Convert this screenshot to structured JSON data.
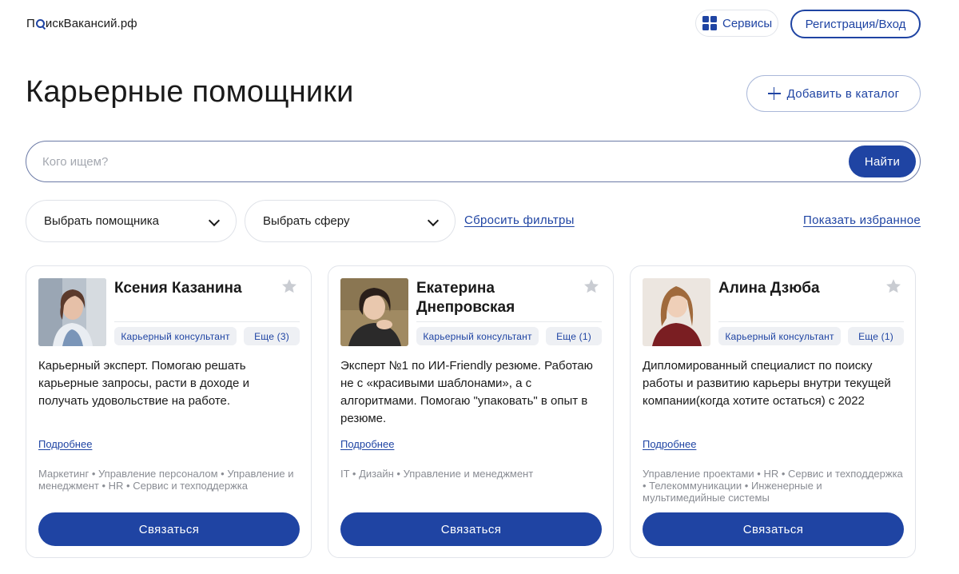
{
  "header": {
    "logo_pre": "П",
    "logo_post": "искВакансий.рф",
    "services_label": "Сервисы",
    "login_label": "Регистрация/Вход"
  },
  "page": {
    "title": "Карьерные помощники",
    "add_label": "Добавить в каталог"
  },
  "search": {
    "placeholder": "Кого ищем?",
    "value": "",
    "button_label": "Найти"
  },
  "filters": {
    "assistant_select": "Выбрать помощника",
    "sphere_select": "Выбрать сферу",
    "reset_label": "Сбросить фильтры",
    "favorites_label": "Показать избранное"
  },
  "cards": [
    {
      "name": "Ксения Казанина",
      "role_tag": "Карьерный консультант",
      "more_tag": "Еще (3)",
      "description": "Карьерный эксперт. Помогаю решать карьерные запросы, расти в доходе и получать удовольствие на работе.",
      "details_label": "Подробнее",
      "spheres": "Маркетинг • Управление персоналом • Управление и менеджмент • HR • Сервис и техподдержка",
      "contact_label": "Связаться"
    },
    {
      "name": "Екатерина Днепровская",
      "role_tag": "Карьерный консультант",
      "more_tag": "Еще (1)",
      "description": "Эксперт №1 по ИИ-Friendly резюме. Работаю не с «красивыми шаблонами», а с алгоритмами. Помогаю \"упаковать\" в опыт в резюме.",
      "details_label": "Подробнее",
      "spheres": "IT • Дизайн • Управление и менеджмент",
      "contact_label": "Связаться"
    },
    {
      "name": "Алина Дзюба",
      "role_tag": "Карьерный консультант",
      "more_tag": "Еще (1)",
      "description": "Дипломированный специалист по поиску работы и развитию карьеры внутри текущей компании(когда хотите остаться) с 2022",
      "details_label": "Подробнее",
      "spheres": "Управление проектами • HR • Сервис и техподдержка • Телекоммуникации • Инженерные и мультимедийные системы",
      "contact_label": "Связаться"
    }
  ],
  "colors": {
    "accent": "#1f44a3",
    "muted_text": "#8a8d94",
    "border": "#e1e4ea",
    "star": "#c9ccd2"
  }
}
